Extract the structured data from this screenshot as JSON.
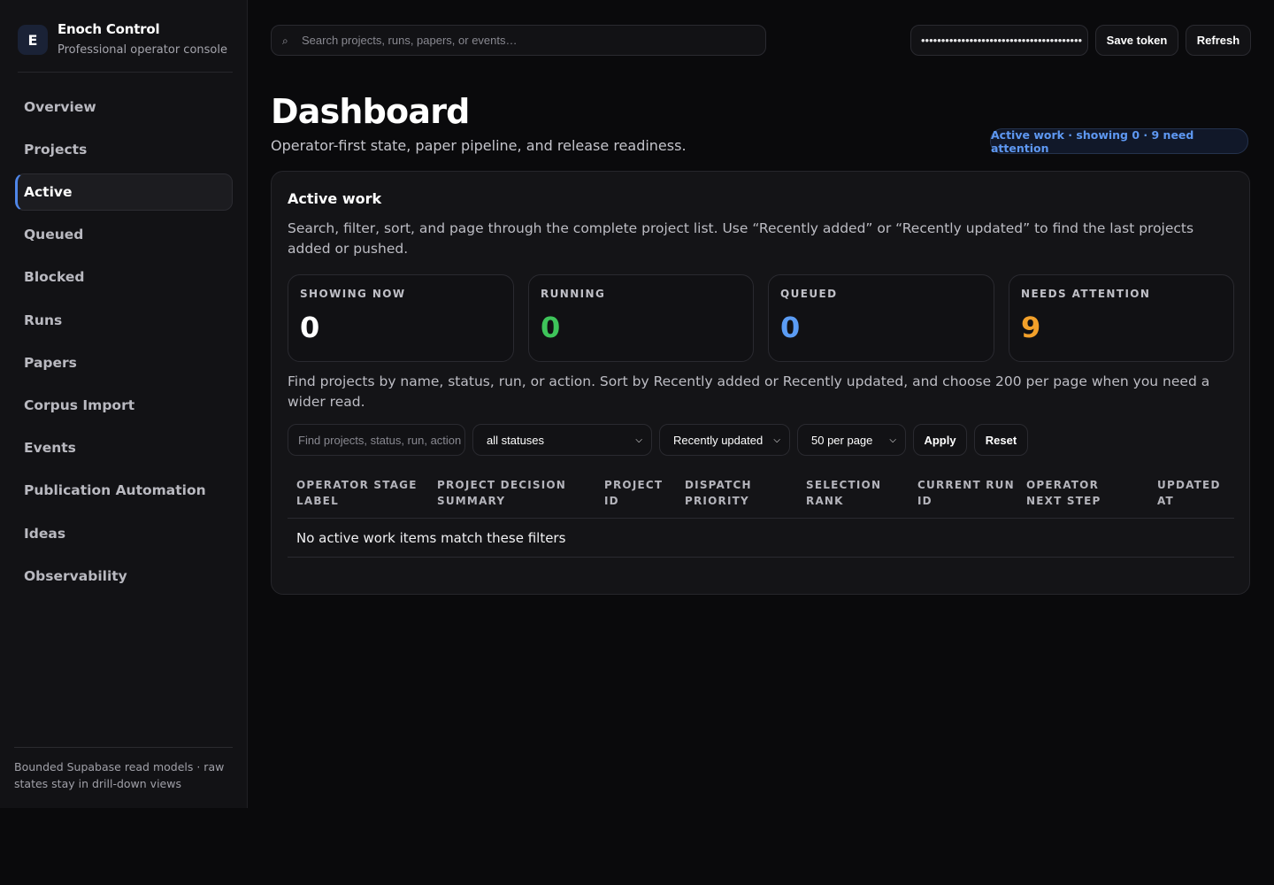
{
  "sidebar": {
    "brand": {
      "logo_letter": "E",
      "title": "Enoch Control",
      "subtitle": "Professional operator console"
    },
    "items": [
      {
        "label": "Overview",
        "active": false
      },
      {
        "label": "Projects",
        "active": false
      },
      {
        "label": "Active",
        "active": true
      },
      {
        "label": "Queued",
        "active": false
      },
      {
        "label": "Blocked",
        "active": false
      },
      {
        "label": "Runs",
        "active": false
      },
      {
        "label": "Papers",
        "active": false
      },
      {
        "label": "Corpus Import",
        "active": false
      },
      {
        "label": "Events",
        "active": false
      },
      {
        "label": "Publication Automation",
        "active": false
      },
      {
        "label": "Ideas",
        "active": false
      },
      {
        "label": "Observability",
        "active": false
      }
    ],
    "footer": "Bounded Supabase read models · raw states stay in drill-down views"
  },
  "topbar": {
    "search_placeholder": "Search projects, runs, papers, or events…",
    "search_icon": "search-icon",
    "token_value": "••••••••••••••••••••••••••••••••••••••••",
    "save_token_label": "Save token",
    "refresh_label": "Refresh"
  },
  "header": {
    "title": "Dashboard",
    "subtitle": "Operator-first state, paper pipeline, and release readiness.",
    "badge": "Active work · showing 0 · 9 need attention",
    "badge_color": "#5e98f2"
  },
  "panel": {
    "title": "Active work",
    "description": "Search, filter, sort, and page through the complete project list. Use “Recently added” or “Recently updated” to find the last projects added or pushed.",
    "stats": [
      {
        "label": "SHOWING NOW",
        "value": "0",
        "color": "#ffffff"
      },
      {
        "label": "RUNNING",
        "value": "0",
        "color": "#3ec45a"
      },
      {
        "label": "QUEUED",
        "value": "0",
        "color": "#5b9cf4"
      },
      {
        "label": "NEEDS ATTENTION",
        "value": "9",
        "color": "#f2a02a"
      }
    ],
    "find_description": "Find projects by name, status, run, or action. Sort by Recently added or Recently updated, and choose 200 per page when you need a wider read.",
    "filters": {
      "input_placeholder": "Find projects, status, run, action",
      "status_selected": "all statuses",
      "sort_selected": "Recently updated",
      "page_size_selected": "50 per page",
      "apply_label": "Apply",
      "reset_label": "Reset"
    },
    "table": {
      "columns": [
        "OPERATOR STAGE LABEL",
        "PROJECT DECISION SUMMARY",
        "PROJECT ID",
        "DISPATCH PRIORITY",
        "SELECTION RANK",
        "CURRENT RUN ID",
        "OPERATOR NEXT STEP",
        "UPDATED AT"
      ],
      "empty_message": "No active work items match these filters"
    }
  }
}
